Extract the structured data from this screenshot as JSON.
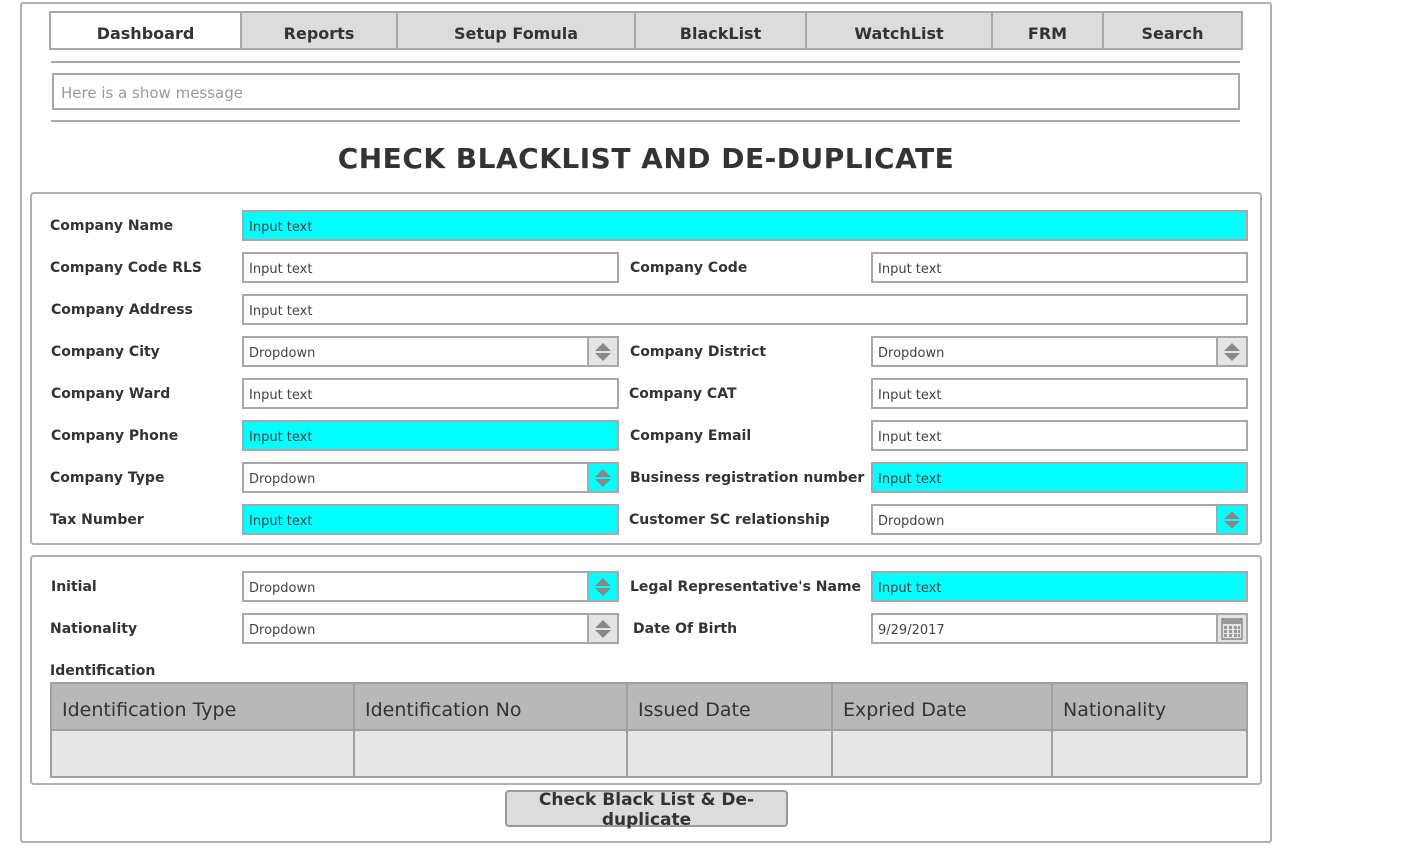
{
  "nav": {
    "tabs": [
      {
        "label": "Dashboard",
        "active": true
      },
      {
        "label": "Reports"
      },
      {
        "label": "Setup Fomula"
      },
      {
        "label": "BlackList"
      },
      {
        "label": "WatchList"
      },
      {
        "label": "FRM"
      },
      {
        "label": "Search"
      }
    ]
  },
  "message": "Here is a show message",
  "page_title": "CHECK BLACKLIST AND DE-DUPLICATE",
  "highlight_color": "#00ffff",
  "company": {
    "name": {
      "label": "Company Name",
      "value": "Input text"
    },
    "code_rls": {
      "label": "Company Code RLS",
      "value": "Input text"
    },
    "code": {
      "label": "Company Code",
      "value": "Input text"
    },
    "address": {
      "label": "Company Address",
      "value": "Input text"
    },
    "city": {
      "label": "Company City",
      "value": "Dropdown"
    },
    "district": {
      "label": "Company District",
      "value": "Dropdown"
    },
    "ward": {
      "label": "Company Ward",
      "value": "Input text"
    },
    "cat": {
      "label": "Company CAT",
      "value": "Input text"
    },
    "phone": {
      "label": "Company Phone",
      "value": "Input text"
    },
    "email": {
      "label": "Company Email",
      "value": "Input text"
    },
    "type": {
      "label": "Company Type",
      "value": "Dropdown"
    },
    "brn": {
      "label": "Business registration number",
      "value": "Input text"
    },
    "tax": {
      "label": "Tax Number",
      "value": "Input text"
    },
    "sc_rel": {
      "label": "Customer SC relationship",
      "value": "Dropdown"
    }
  },
  "rep": {
    "initial": {
      "label": "Initial",
      "value": "Dropdown"
    },
    "legal_name": {
      "label": "Legal Representative's Name",
      "value": "Input text"
    },
    "nationality": {
      "label": "Nationality",
      "value": "Dropdown"
    },
    "dob": {
      "label": "Date Of Birth",
      "value": "9/29/2017"
    },
    "identification_label": "Identification",
    "id_table": {
      "columns": [
        "Identification Type",
        "Identification No",
        "Issued Date",
        "Expried Date",
        "Nationality"
      ]
    }
  },
  "actions": {
    "check_button": "Check Black List & De-duplicate"
  }
}
